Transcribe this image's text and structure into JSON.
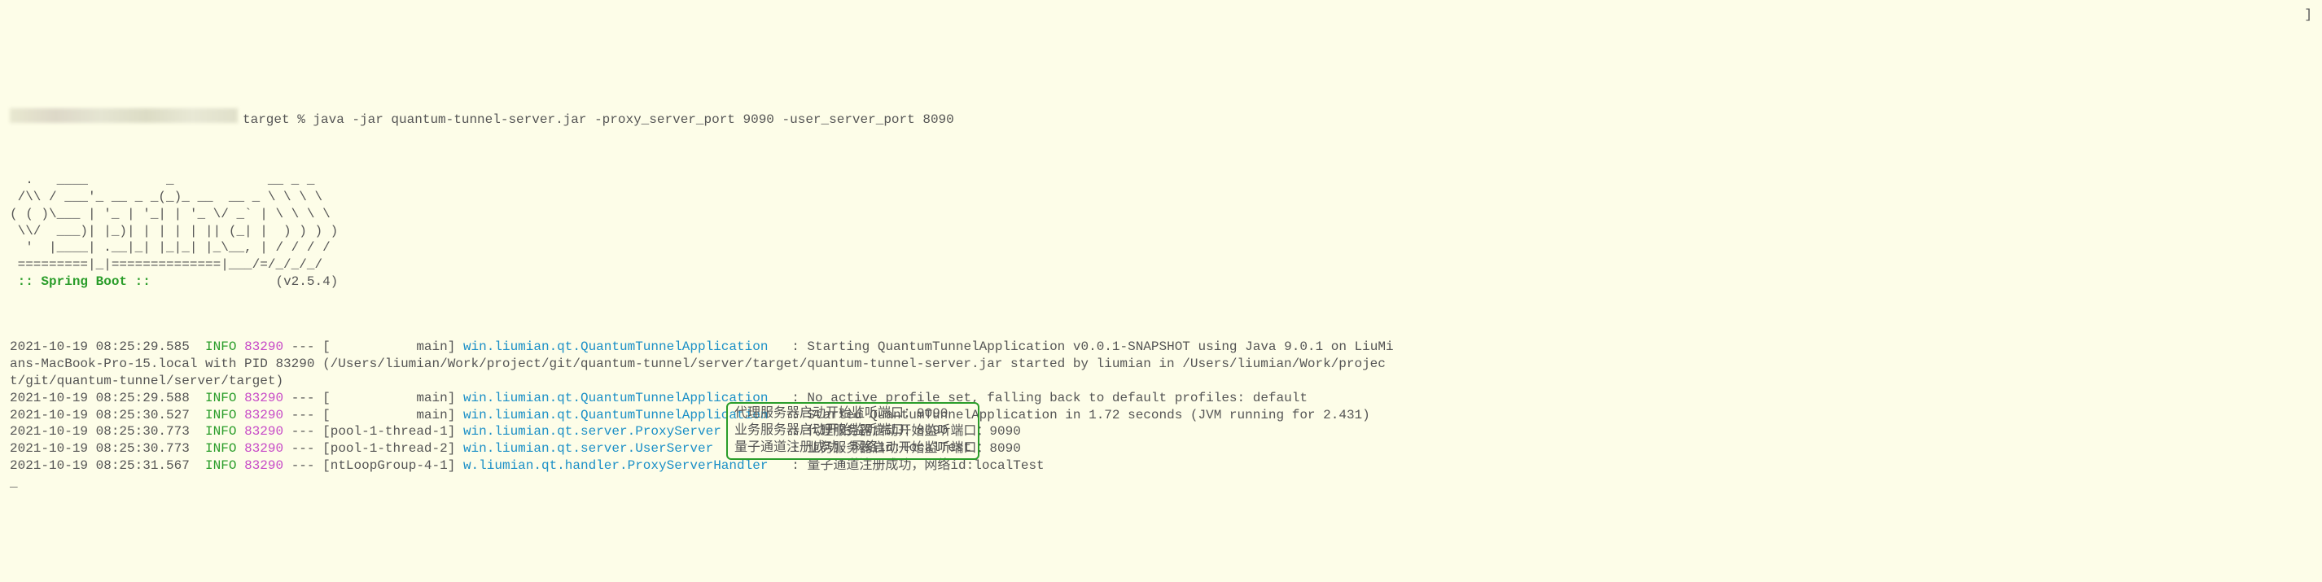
{
  "prompt": {
    "visible_text": "target % java -jar quantum-tunnel-server.jar -proxy_server_port 9090 -user_server_port 8090",
    "right_bracket": "]"
  },
  "ascii_art": {
    "line1": "  .   ____          _            __ _ _",
    "line2": " /\\\\ / ___'_ __ _ _(_)_ __  __ _ \\ \\ \\ \\",
    "line3": "( ( )\\___ | '_ | '_| | '_ \\/ _` | \\ \\ \\ \\",
    "line4": " \\\\/  ___)| |_)| | | | | || (_| |  ) ) ) )",
    "line5": "  '  |____| .__|_| |_|_| |_\\__, | / / / /",
    "line6": " =========|_|==============|___/=/_/_/_/"
  },
  "spring_boot_label": " :: Spring Boot :: ",
  "spring_boot_version": "(v2.5.4)",
  "logs": [
    {
      "ts": "2021-10-19 08:25:29.585",
      "level": "INFO",
      "pid": "83290",
      "sep": "---",
      "thread": "[           main]",
      "logger": "win.liumian.qt.QuantumTunnelApplication",
      "colon": "   :",
      "msg": " Starting QuantumTunnelApplication v0.0.1-SNAPSHOT using Java 9.0.1 on LiuMi"
    }
  ],
  "log_wrap1": "ans-MacBook-Pro-15.local with PID 83290 (/Users/liumian/Work/project/git/quantum-tunnel/server/target/quantum-tunnel-server.jar started by liumian in /Users/liumian/Work/projec",
  "log_wrap2": "t/git/quantum-tunnel/server/target)",
  "logs2": [
    {
      "ts": "2021-10-19 08:25:29.588",
      "level": "INFO",
      "pid": "83290",
      "sep": "---",
      "thread": "[           main]",
      "logger": "win.liumian.qt.QuantumTunnelApplication",
      "colon": "   :",
      "msg": " No active profile set, falling back to default profiles: default"
    },
    {
      "ts": "2021-10-19 08:25:30.527",
      "level": "INFO",
      "pid": "83290",
      "sep": "---",
      "thread": "[           main]",
      "logger": "win.liumian.qt.QuantumTunnelApplication",
      "colon": "   :",
      "msg": " Started QuantumTunnelApplication in 1.72 seconds (JVM running for 2.431)"
    },
    {
      "ts": "2021-10-19 08:25:30.773",
      "level": "INFO",
      "pid": "83290",
      "sep": "---",
      "thread": "[pool-1-thread-1]",
      "logger": "win.liumian.qt.server.ProxyServer",
      "colon": "         :",
      "msg": " 代理服务器启动开始监听端口：9090"
    },
    {
      "ts": "2021-10-19 08:25:30.773",
      "level": "INFO",
      "pid": "83290",
      "sep": "---",
      "thread": "[pool-1-thread-2]",
      "logger": "win.liumian.qt.server.UserServer",
      "colon": "          :",
      "msg": " 业务服务器启动开始监听端口：8090"
    },
    {
      "ts": "2021-10-19 08:25:31.567",
      "level": "INFO",
      "pid": "83290",
      "sep": "---",
      "thread": "[ntLoopGroup-4-1]",
      "logger": "w.liumian.qt.handler.ProxyServerHandler",
      "colon": "   :",
      "msg": " 量子通道注册成功，网络id:localTest"
    }
  ],
  "highlight": {
    "line1": "代理服务器启动开始监听端口：9090",
    "line2": "业务服务器启动开始监听端口：8090",
    "line3": "量子通道注册成功，网络id:localTest"
  },
  "cursor": "_"
}
